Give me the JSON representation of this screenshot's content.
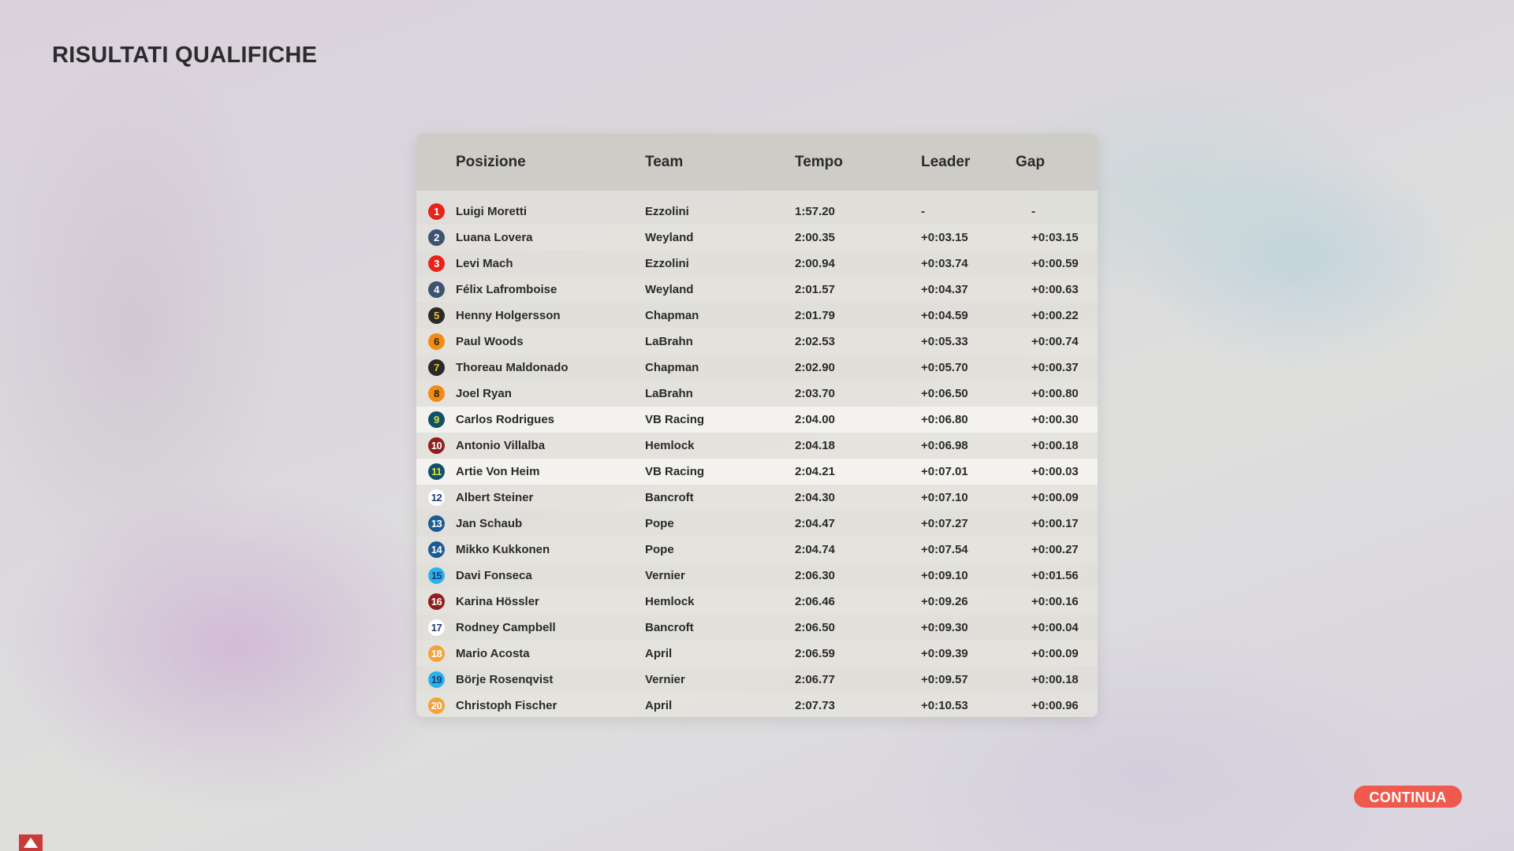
{
  "title": "RISULTATI QUALIFICHE",
  "columns": {
    "position": "Posizione",
    "team": "Team",
    "time": "Tempo",
    "leader": "Leader",
    "gap": "Gap"
  },
  "rows": [
    {
      "pos": "1",
      "driver": "Luigi Moretti",
      "team": "Ezzolini",
      "time": "1:57.20",
      "leader": "-",
      "gap": "-",
      "badge_bg": "#e8231c",
      "badge_fg": "#ffffff"
    },
    {
      "pos": "2",
      "driver": "Luana Lovera",
      "team": "Weyland",
      "time": "2:00.35",
      "leader": "+0:03.15",
      "gap": "+0:03.15",
      "badge_bg": "#3d5470",
      "badge_fg": "#ffffff"
    },
    {
      "pos": "3",
      "driver": "Levi Mach",
      "team": "Ezzolini",
      "time": "2:00.94",
      "leader": "+0:03.74",
      "gap": "+0:00.59",
      "badge_bg": "#e8231c",
      "badge_fg": "#ffffff"
    },
    {
      "pos": "4",
      "driver": "Félix Lafromboise",
      "team": "Weyland",
      "time": "2:01.57",
      "leader": "+0:04.37",
      "gap": "+0:00.63",
      "badge_bg": "#3d5470",
      "badge_fg": "#ffffff"
    },
    {
      "pos": "5",
      "driver": "Henny Holgersson",
      "team": "Chapman",
      "time": "2:01.79",
      "leader": "+0:04.59",
      "gap": "+0:00.22",
      "badge_bg": "#2a2a2a",
      "badge_fg": "#f2c230"
    },
    {
      "pos": "6",
      "driver": "Paul Woods",
      "team": "LaBrahn",
      "time": "2:02.53",
      "leader": "+0:05.33",
      "gap": "+0:00.74",
      "badge_bg": "#f28a13",
      "badge_fg": "#222222"
    },
    {
      "pos": "7",
      "driver": "Thoreau Maldonado",
      "team": "Chapman",
      "time": "2:02.90",
      "leader": "+0:05.70",
      "gap": "+0:00.37",
      "badge_bg": "#2a2a2a",
      "badge_fg": "#f2c230"
    },
    {
      "pos": "8",
      "driver": "Joel Ryan",
      "team": "LaBrahn",
      "time": "2:03.70",
      "leader": "+0:06.50",
      "gap": "+0:00.80",
      "badge_bg": "#f28a13",
      "badge_fg": "#222222"
    },
    {
      "pos": "9",
      "driver": "Carlos Rodrigues",
      "team": "VB Racing",
      "time": "2:04.00",
      "leader": "+0:06.80",
      "gap": "+0:00.30",
      "badge_bg": "#12506a",
      "badge_fg": "#d8e23a"
    },
    {
      "pos": "10",
      "driver": "Antonio Villalba",
      "team": "Hemlock",
      "time": "2:04.18",
      "leader": "+0:06.98",
      "gap": "+0:00.18",
      "badge_bg": "#8e1f1f",
      "badge_fg": "#ffffff"
    },
    {
      "pos": "11",
      "driver": "Artie Von Heim",
      "team": "VB Racing",
      "time": "2:04.21",
      "leader": "+0:07.01",
      "gap": "+0:00.03",
      "badge_bg": "#12506a",
      "badge_fg": "#d8e23a"
    },
    {
      "pos": "12",
      "driver": "Albert Steiner",
      "team": "Bancroft",
      "time": "2:04.30",
      "leader": "+0:07.10",
      "gap": "+0:00.09",
      "badge_bg": "#ffffff",
      "badge_fg": "#1c3a78"
    },
    {
      "pos": "13",
      "driver": "Jan Schaub",
      "team": "Pope",
      "time": "2:04.47",
      "leader": "+0:07.27",
      "gap": "+0:00.17",
      "badge_bg": "#1a5b96",
      "badge_fg": "#ffffff"
    },
    {
      "pos": "14",
      "driver": "Mikko Kukkonen",
      "team": "Pope",
      "time": "2:04.74",
      "leader": "+0:07.54",
      "gap": "+0:00.27",
      "badge_bg": "#1a5b96",
      "badge_fg": "#ffffff"
    },
    {
      "pos": "15",
      "driver": "Davi Fonseca",
      "team": "Vernier",
      "time": "2:06.30",
      "leader": "+0:09.10",
      "gap": "+0:01.56",
      "badge_bg": "#2ab2ea",
      "badge_fg": "#1c3a78"
    },
    {
      "pos": "16",
      "driver": "Karina Hössler",
      "team": "Hemlock",
      "time": "2:06.46",
      "leader": "+0:09.26",
      "gap": "+0:00.16",
      "badge_bg": "#8e1f1f",
      "badge_fg": "#ffffff"
    },
    {
      "pos": "17",
      "driver": "Rodney Campbell",
      "team": "Bancroft",
      "time": "2:06.50",
      "leader": "+0:09.30",
      "gap": "+0:00.04",
      "badge_bg": "#ffffff",
      "badge_fg": "#1c3a78"
    },
    {
      "pos": "18",
      "driver": "Mario Acosta",
      "team": "April",
      "time": "2:06.59",
      "leader": "+0:09.39",
      "gap": "+0:00.09",
      "badge_bg": "#f5a23a",
      "badge_fg": "#ffffff"
    },
    {
      "pos": "19",
      "driver": "Börje Rosenqvist",
      "team": "Vernier",
      "time": "2:06.77",
      "leader": "+0:09.57",
      "gap": "+0:00.18",
      "badge_bg": "#2ab2ea",
      "badge_fg": "#1c3a78"
    },
    {
      "pos": "20",
      "driver": "Christoph Fischer",
      "team": "April",
      "time": "2:07.73",
      "leader": "+0:10.53",
      "gap": "+0:00.96",
      "badge_bg": "#f5a23a",
      "badge_fg": "#ffffff"
    }
  ],
  "highlighted_positions": [
    "9",
    "11"
  ],
  "continue_label": "CONTINUA",
  "continue_color": "#ef5a4e",
  "corner_icon": "warning-triangle-icon"
}
